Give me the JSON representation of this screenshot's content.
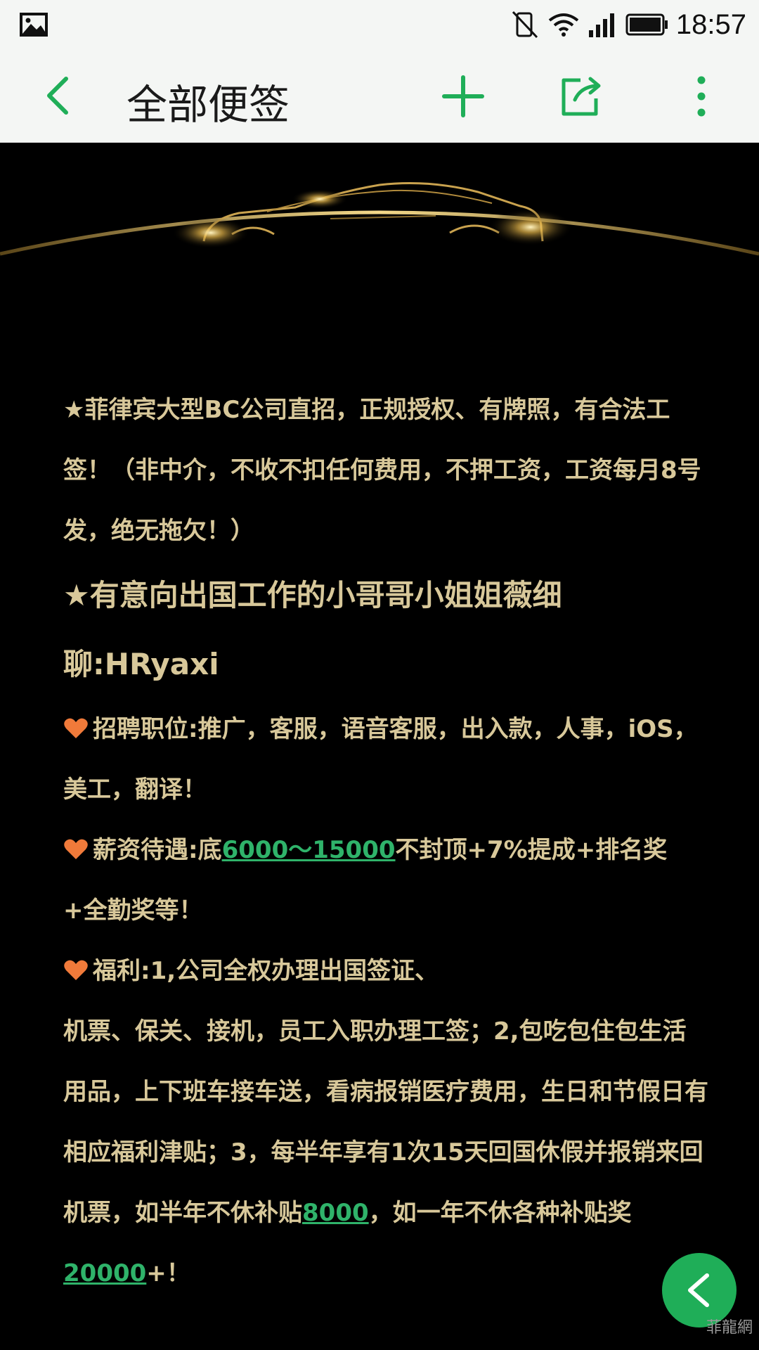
{
  "status_bar": {
    "time": "18:57",
    "icons": [
      "gallery-icon",
      "vibrate-off-icon",
      "wifi-icon",
      "signal-icon",
      "battery-icon"
    ]
  },
  "toolbar": {
    "title": "全部便签",
    "icons": [
      "back-icon",
      "add-icon",
      "share-icon",
      "more-icon"
    ],
    "accent_color": "#1fae58"
  },
  "content": {
    "p1": "★菲律宾大型BC公司直招，正规授权、有牌照，有合法工签！（非中介，不收不扣任何费用，不押工资，工资每月8号发，绝无拖欠！）",
    "p2": "★有意向出国工作的小哥哥小姐姐薇细聊:HRyaxi",
    "p3": "招聘职位:推广，客服，语音客服，出入款，人事，iOS，美工，翻译！",
    "p4_before": "薪资待遇:底",
    "p4_link": "6000～15000",
    "p4_after": "不封顶+7%提成+排名奖+全勤奖等！",
    "p5_line1": "福利:1,公司全权办理出国签证、",
    "p5_before": "机票、保关、接机，员工入职办理工签；2,包吃包住包生活用品，上下班车接车送，看病报销医疗费用，生日和节假日有相应福利津贴；3，每半年享有1次15天回国休假并报销来回机票，如半年不休补贴",
    "p5_link1": "8000",
    "p5_middle": "，如一年不休各种补贴奖",
    "p5_link2": "20000",
    "p5_after": "+！",
    "text_color": "#d8c89a",
    "link_color": "#2fb36a",
    "heart_color": "#f07a3a"
  },
  "fab": {
    "icon": "collapse-chevron-icon"
  },
  "watermark": "菲龍網"
}
